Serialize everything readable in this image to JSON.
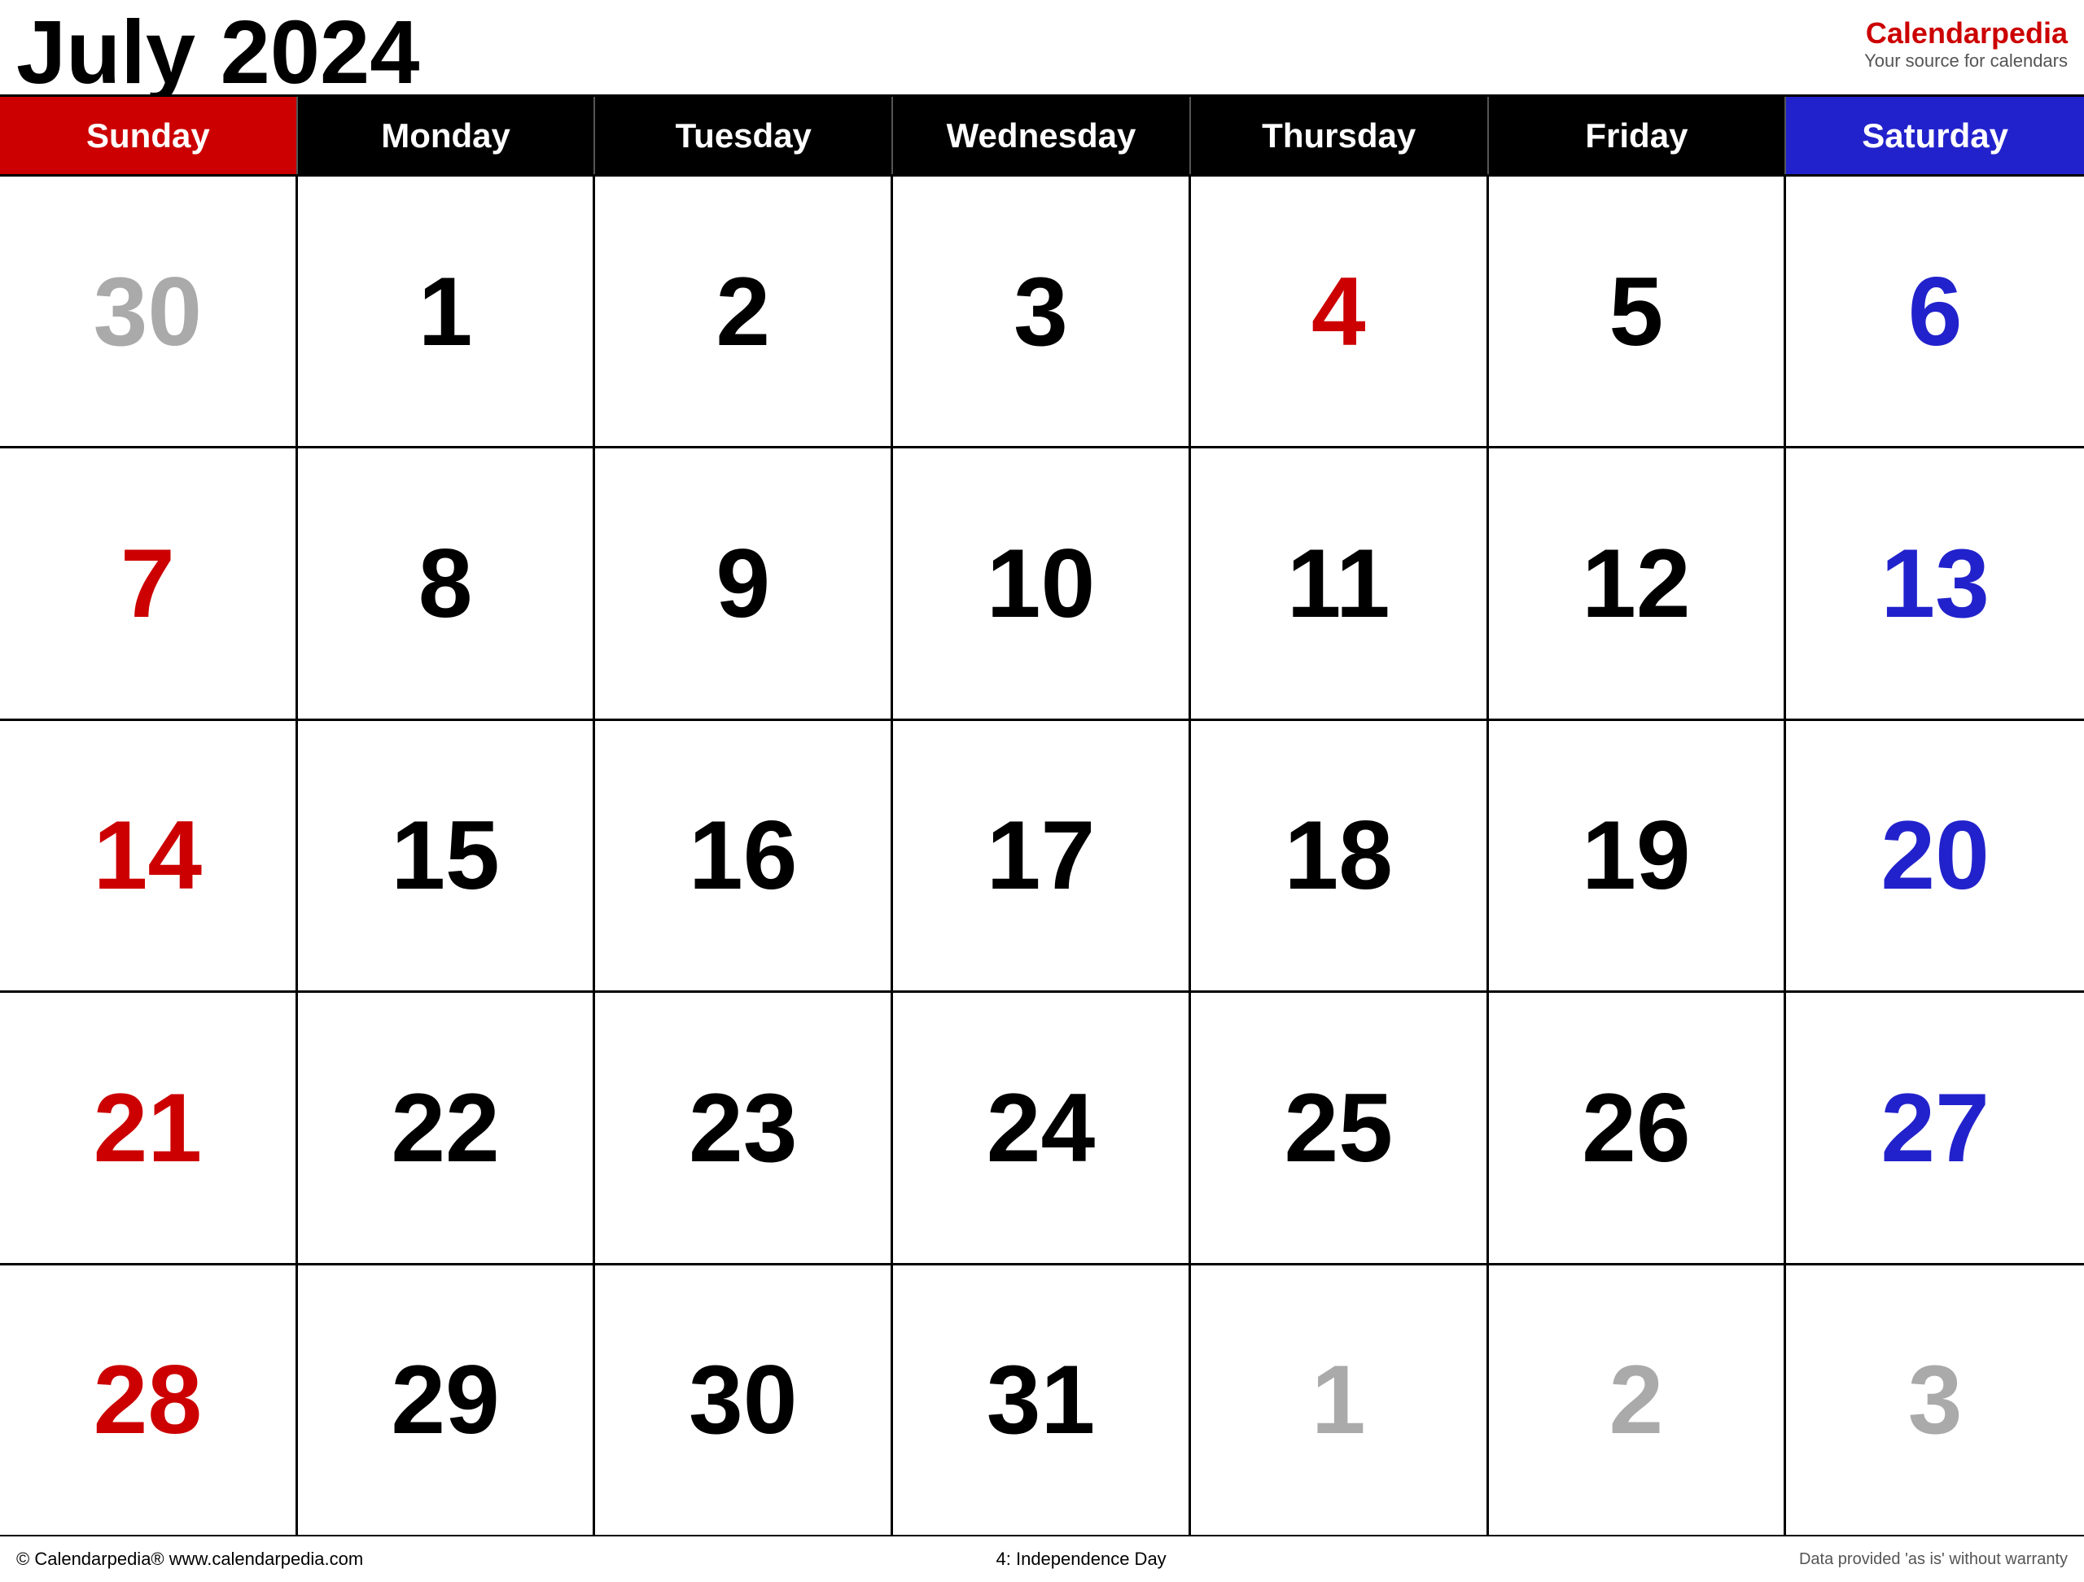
{
  "header": {
    "month_year": "July 2024",
    "brand_name_regular": "Calendar",
    "brand_name_accent": "pedia",
    "brand_tagline": "Your source for calendars"
  },
  "day_headers": [
    {
      "label": "Sunday",
      "type": "sunday"
    },
    {
      "label": "Monday",
      "type": "weekday"
    },
    {
      "label": "Tuesday",
      "type": "weekday"
    },
    {
      "label": "Wednesday",
      "type": "weekday"
    },
    {
      "label": "Thursday",
      "type": "weekday"
    },
    {
      "label": "Friday",
      "type": "weekday"
    },
    {
      "label": "Saturday",
      "type": "saturday"
    }
  ],
  "weeks": [
    [
      {
        "day": "30",
        "type": "other-month"
      },
      {
        "day": "1",
        "type": "weekday"
      },
      {
        "day": "2",
        "type": "weekday"
      },
      {
        "day": "3",
        "type": "weekday"
      },
      {
        "day": "4",
        "type": "holiday"
      },
      {
        "day": "5",
        "type": "weekday"
      },
      {
        "day": "6",
        "type": "saturday"
      }
    ],
    [
      {
        "day": "7",
        "type": "sunday"
      },
      {
        "day": "8",
        "type": "weekday"
      },
      {
        "day": "9",
        "type": "weekday"
      },
      {
        "day": "10",
        "type": "weekday"
      },
      {
        "day": "11",
        "type": "weekday"
      },
      {
        "day": "12",
        "type": "weekday"
      },
      {
        "day": "13",
        "type": "saturday"
      }
    ],
    [
      {
        "day": "14",
        "type": "sunday"
      },
      {
        "day": "15",
        "type": "weekday"
      },
      {
        "day": "16",
        "type": "weekday"
      },
      {
        "day": "17",
        "type": "weekday"
      },
      {
        "day": "18",
        "type": "weekday"
      },
      {
        "day": "19",
        "type": "weekday"
      },
      {
        "day": "20",
        "type": "saturday"
      }
    ],
    [
      {
        "day": "21",
        "type": "sunday"
      },
      {
        "day": "22",
        "type": "weekday"
      },
      {
        "day": "23",
        "type": "weekday"
      },
      {
        "day": "24",
        "type": "weekday"
      },
      {
        "day": "25",
        "type": "weekday"
      },
      {
        "day": "26",
        "type": "weekday"
      },
      {
        "day": "27",
        "type": "saturday"
      }
    ],
    [
      {
        "day": "28",
        "type": "sunday"
      },
      {
        "day": "29",
        "type": "weekday"
      },
      {
        "day": "30",
        "type": "weekday"
      },
      {
        "day": "31",
        "type": "weekday"
      },
      {
        "day": "1",
        "type": "other-month"
      },
      {
        "day": "2",
        "type": "other-month"
      },
      {
        "day": "3",
        "type": "other-month"
      }
    ]
  ],
  "footer": {
    "left": "© Calendarpedia®   www.calendarpedia.com",
    "center": "4: Independence Day",
    "right": "Data provided 'as is' without warranty"
  }
}
